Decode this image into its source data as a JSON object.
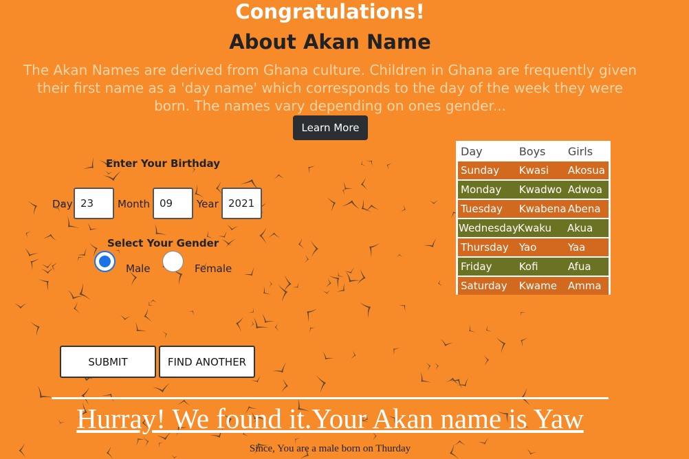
{
  "header": {
    "title": "Congratulations!",
    "about_heading": "About Akan Name",
    "description": "The Akan Names are derived from Ghana culture. Children in Ghana are frequently given their first name as a 'day name' which corresponds to the day of the week they were born. The names vary depending on ones gender...",
    "learn_more_label": "Learn More"
  },
  "form": {
    "birthday_label": "Enter Your Birthday",
    "day_label": "Day",
    "day_value": "23",
    "month_label": "Month",
    "month_value": "09",
    "year_label": "Year",
    "year_value": "2021",
    "gender_label": "Select Your Gender",
    "male_label": "Male",
    "female_label": "Female",
    "selected_gender": "Male",
    "submit_label": "SUBMIT",
    "find_another_label": "FIND ANOTHER"
  },
  "names_table": {
    "headers": [
      "Day",
      "Boys",
      "Girls"
    ],
    "rows": [
      {
        "day": "Sunday",
        "boy": "Kwasi",
        "girl": "Akosua"
      },
      {
        "day": "Monday",
        "boy": "Kwadwo",
        "girl": "Adwoa"
      },
      {
        "day": "Tuesday",
        "boy": "Kwabena",
        "girl": "Abena"
      },
      {
        "day": "Wednesday",
        "boy": "Kwaku",
        "girl": "Akua"
      },
      {
        "day": "Thursday",
        "boy": "Yao",
        "girl": "Yaa"
      },
      {
        "day": "Friday",
        "boy": "Kofi",
        "girl": "Afua"
      },
      {
        "day": "Saturday",
        "boy": "Kwame",
        "girl": "Amma"
      }
    ]
  },
  "result": {
    "heading": "Hurray! We found it.Your Akan name is Yaw",
    "subtext": "Since, You are a male born on Thurday"
  },
  "colors": {
    "background": "#f78b2a",
    "row_orange": "#d2691e",
    "row_olive": "#6b7222",
    "button_dark": "#2b2f33",
    "radio_blue": "#1a73e8"
  }
}
